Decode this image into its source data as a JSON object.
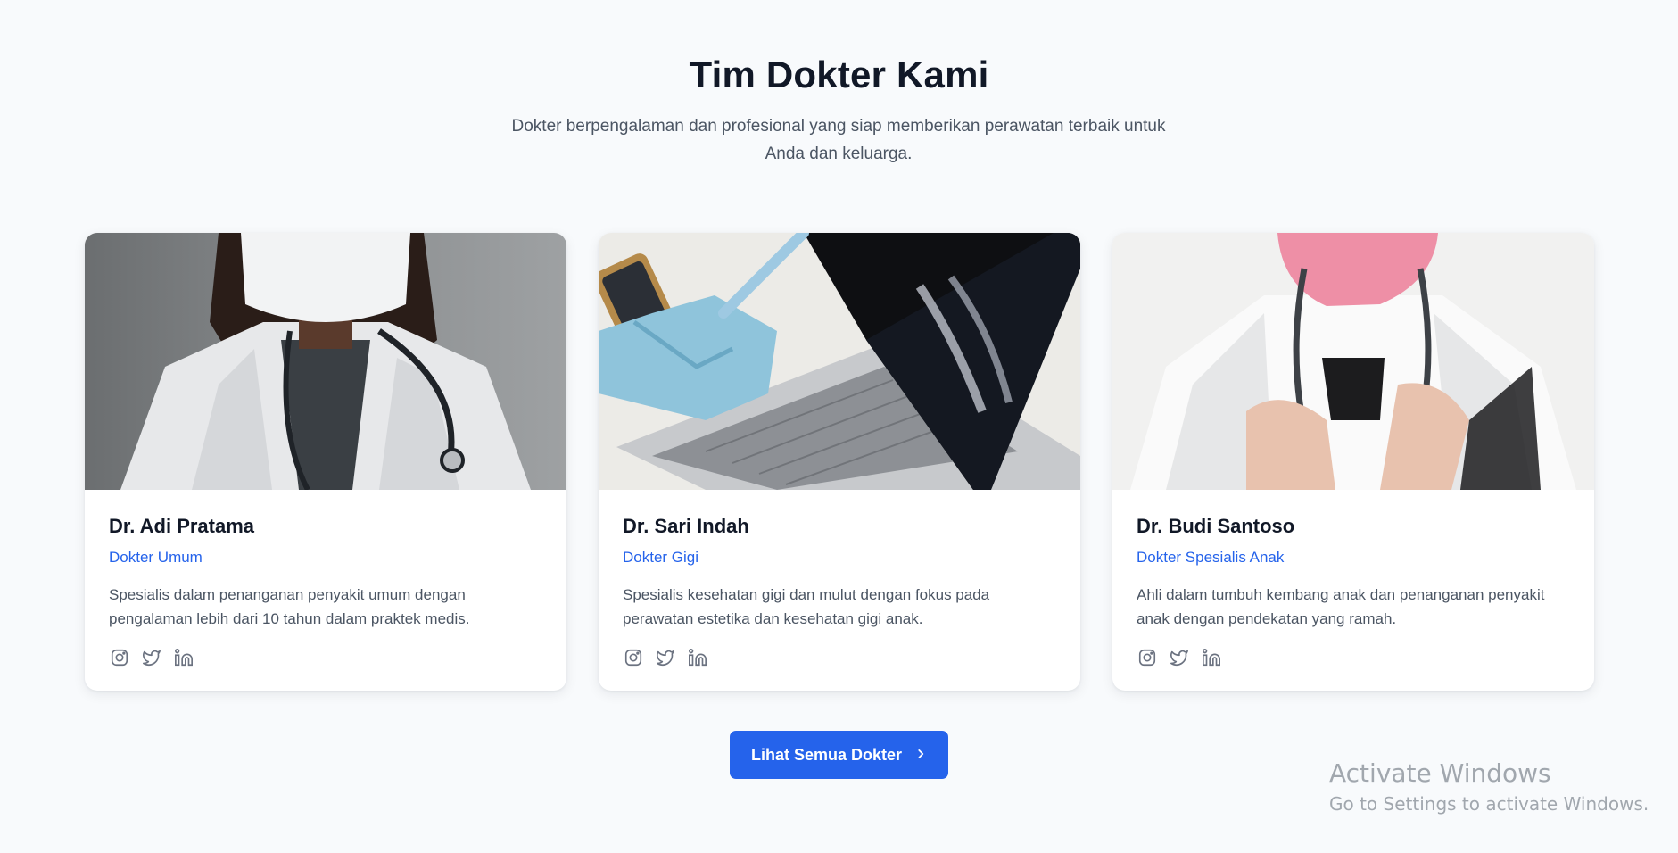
{
  "section": {
    "title": "Tim Dokter Kami",
    "subtitle": "Dokter berpengalaman dan profesional yang siap memberikan perawatan terbaik untuk Anda dan keluarga."
  },
  "doctors": [
    {
      "name": "Dr. Adi Pratama",
      "specialty": "Dokter Umum",
      "description": "Spesialis dalam penanganan penyakit umum dengan pengalaman lebih dari 10 tahun dalam praktek medis.",
      "photo": "doctor-with-white-mask-and-stethoscope-photo"
    },
    {
      "name": "Dr. Sari Indah",
      "specialty": "Dokter Gigi",
      "description": "Spesialis kesehatan gigi dan mulut dengan fokus pada perawatan estetika dan kesehatan gigi anak.",
      "photo": "gloved-hand-pointing-at-xray-on-laptop-photo"
    },
    {
      "name": "Dr. Budi Santoso",
      "specialty": "Dokter Spesialis Anak",
      "description": "Ahli dalam tumbuh kembang anak dan penanganan penyakit anak dengan pendekatan yang ramah.",
      "photo": "doctor-with-pink-mask-and-stethoscope-photo"
    }
  ],
  "socials": [
    "instagram-icon",
    "twitter-icon",
    "linkedin-icon"
  ],
  "cta": {
    "label": "Lihat Semua Dokter",
    "icon": "chevron-right-icon"
  },
  "watermark": {
    "title": "Activate Windows",
    "subtitle": "Go to Settings to activate Windows."
  },
  "colors": {
    "background": "#f8fafc",
    "accent": "#2563eb",
    "heading": "#111827",
    "body_text": "#4b5563"
  }
}
